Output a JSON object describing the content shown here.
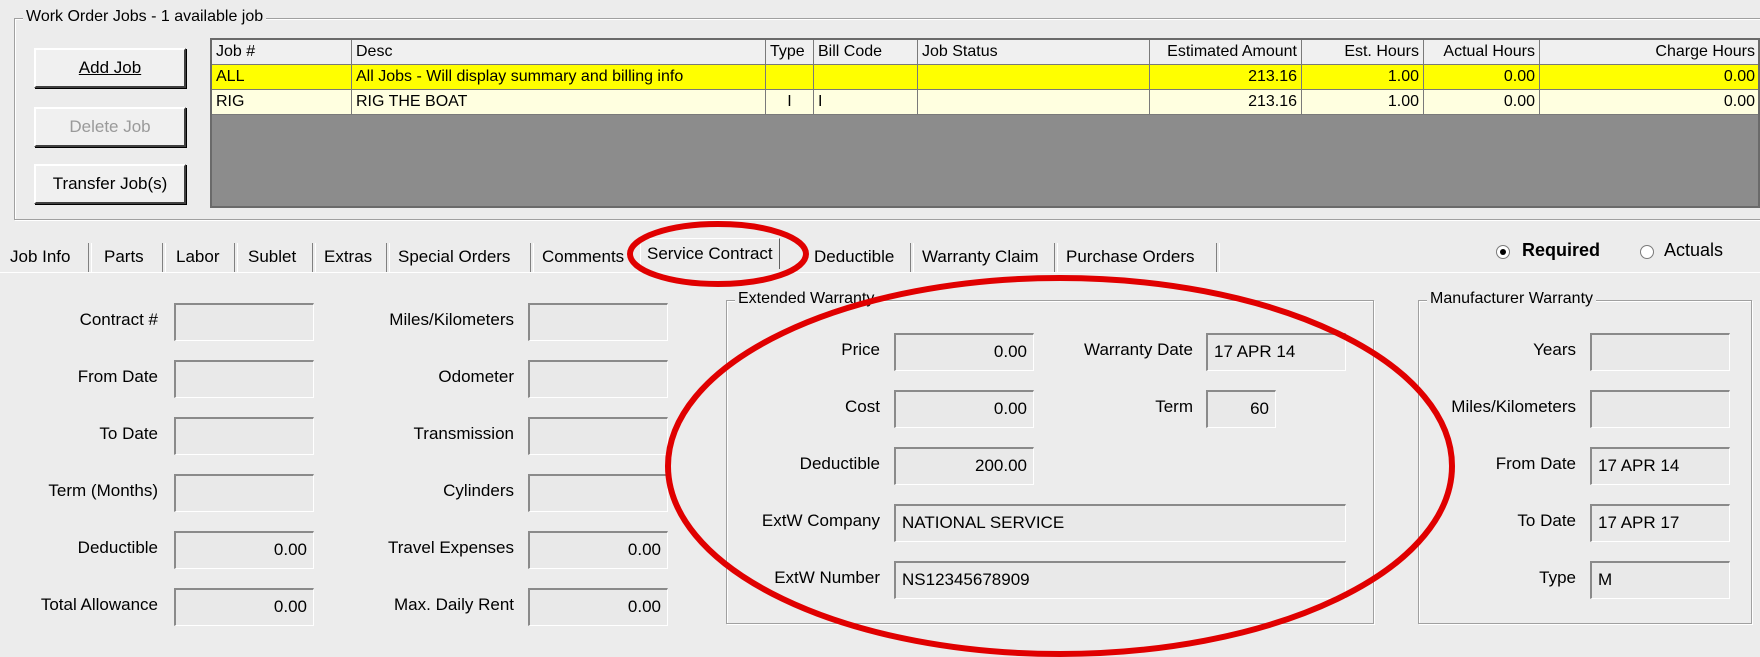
{
  "jobs_group": {
    "title": "Work Order Jobs - 1 available job",
    "buttons": {
      "add": "Add Job",
      "delete": "Delete Job",
      "transfer": "Transfer Job(s)"
    },
    "columns": [
      "Job #",
      "Desc",
      "Type",
      "Bill Code",
      "Job Status",
      "Estimated Amount",
      "Est. Hours",
      "Actual Hours",
      "Charge Hours"
    ],
    "rows": [
      [
        "ALL",
        "All Jobs - Will display summary and billing info",
        "",
        "",
        "",
        "213.16",
        "1.00",
        "0.00",
        "0.00"
      ],
      [
        "RIG",
        "RIG THE BOAT",
        "I",
        "I",
        "",
        "213.16",
        "1.00",
        "0.00",
        "0.00"
      ]
    ]
  },
  "tabs": [
    "Job Info",
    "Parts",
    "Labor",
    "Sublet",
    "Extras",
    "Special Orders",
    "Comments",
    "Service Contract",
    "Deductible",
    "Warranty Claim",
    "Purchase Orders"
  ],
  "active_tab": "Service Contract",
  "mode": {
    "required": "Required",
    "actuals": "Actuals",
    "selected": "Required"
  },
  "contract": {
    "contract_no": {
      "label": "Contract #",
      "value": ""
    },
    "from_date": {
      "label": "From Date",
      "value": ""
    },
    "to_date": {
      "label": "To Date",
      "value": ""
    },
    "term_months": {
      "label": "Term (Months)",
      "value": ""
    },
    "deductible": {
      "label": "Deductible",
      "value": "0.00"
    },
    "total_allowance": {
      "label": "Total Allowance",
      "value": "0.00"
    },
    "miles": {
      "label": "Miles/Kilometers",
      "value": ""
    },
    "odometer": {
      "label": "Odometer",
      "value": ""
    },
    "transmission": {
      "label": "Transmission",
      "value": ""
    },
    "cylinders": {
      "label": "Cylinders",
      "value": ""
    },
    "travel_expenses": {
      "label": "Travel Expenses",
      "value": "0.00"
    },
    "max_daily_rent": {
      "label": "Max. Daily Rent",
      "value": "0.00"
    }
  },
  "extended_warranty": {
    "title": "Extended Warranty",
    "price": {
      "label": "Price",
      "value": "0.00"
    },
    "cost": {
      "label": "Cost",
      "value": "0.00"
    },
    "deductible": {
      "label": "Deductible",
      "value": "200.00"
    },
    "warranty_date": {
      "label": "Warranty Date",
      "value": "17 APR 14"
    },
    "term": {
      "label": "Term",
      "value": "60"
    },
    "company": {
      "label": "ExtW Company",
      "value": "NATIONAL SERVICE"
    },
    "number": {
      "label": "ExtW Number",
      "value": "NS12345678909"
    }
  },
  "manufacturer_warranty": {
    "title": "Manufacturer Warranty",
    "years": {
      "label": "Years",
      "value": ""
    },
    "miles": {
      "label": "Miles/Kilometers",
      "value": ""
    },
    "from_date": {
      "label": "From Date",
      "value": "17 APR 14"
    },
    "to_date": {
      "label": "To Date",
      "value": "17 APR 17"
    },
    "type": {
      "label": "Type",
      "value": "M"
    }
  },
  "colors": {
    "highlight_row": "#ffff00",
    "row": "#ffffe0",
    "annotation_circle": "#e00000"
  }
}
